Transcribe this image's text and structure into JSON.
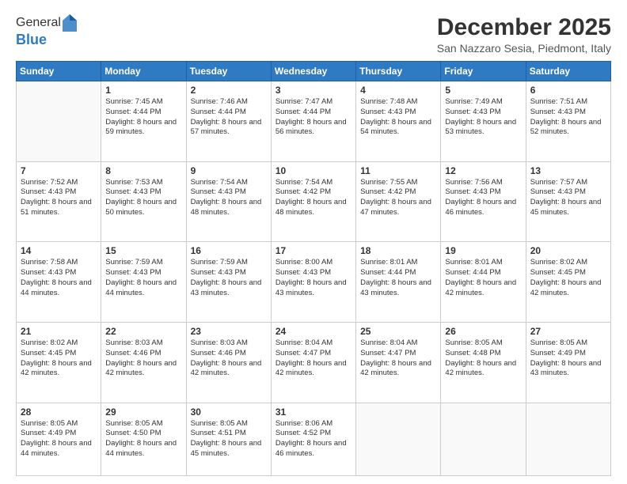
{
  "header": {
    "logo_general": "General",
    "logo_blue": "Blue",
    "month": "December 2025",
    "location": "San Nazzaro Sesia, Piedmont, Italy"
  },
  "days_of_week": [
    "Sunday",
    "Monday",
    "Tuesday",
    "Wednesday",
    "Thursday",
    "Friday",
    "Saturday"
  ],
  "weeks": [
    [
      {
        "day": "",
        "sunrise": "",
        "sunset": "",
        "daylight": ""
      },
      {
        "day": "1",
        "sunrise": "Sunrise: 7:45 AM",
        "sunset": "Sunset: 4:44 PM",
        "daylight": "Daylight: 8 hours and 59 minutes."
      },
      {
        "day": "2",
        "sunrise": "Sunrise: 7:46 AM",
        "sunset": "Sunset: 4:44 PM",
        "daylight": "Daylight: 8 hours and 57 minutes."
      },
      {
        "day": "3",
        "sunrise": "Sunrise: 7:47 AM",
        "sunset": "Sunset: 4:44 PM",
        "daylight": "Daylight: 8 hours and 56 minutes."
      },
      {
        "day": "4",
        "sunrise": "Sunrise: 7:48 AM",
        "sunset": "Sunset: 4:43 PM",
        "daylight": "Daylight: 8 hours and 54 minutes."
      },
      {
        "day": "5",
        "sunrise": "Sunrise: 7:49 AM",
        "sunset": "Sunset: 4:43 PM",
        "daylight": "Daylight: 8 hours and 53 minutes."
      },
      {
        "day": "6",
        "sunrise": "Sunrise: 7:51 AM",
        "sunset": "Sunset: 4:43 PM",
        "daylight": "Daylight: 8 hours and 52 minutes."
      }
    ],
    [
      {
        "day": "7",
        "sunrise": "Sunrise: 7:52 AM",
        "sunset": "Sunset: 4:43 PM",
        "daylight": "Daylight: 8 hours and 51 minutes."
      },
      {
        "day": "8",
        "sunrise": "Sunrise: 7:53 AM",
        "sunset": "Sunset: 4:43 PM",
        "daylight": "Daylight: 8 hours and 50 minutes."
      },
      {
        "day": "9",
        "sunrise": "Sunrise: 7:54 AM",
        "sunset": "Sunset: 4:43 PM",
        "daylight": "Daylight: 8 hours and 48 minutes."
      },
      {
        "day": "10",
        "sunrise": "Sunrise: 7:54 AM",
        "sunset": "Sunset: 4:42 PM",
        "daylight": "Daylight: 8 hours and 48 minutes."
      },
      {
        "day": "11",
        "sunrise": "Sunrise: 7:55 AM",
        "sunset": "Sunset: 4:42 PM",
        "daylight": "Daylight: 8 hours and 47 minutes."
      },
      {
        "day": "12",
        "sunrise": "Sunrise: 7:56 AM",
        "sunset": "Sunset: 4:43 PM",
        "daylight": "Daylight: 8 hours and 46 minutes."
      },
      {
        "day": "13",
        "sunrise": "Sunrise: 7:57 AM",
        "sunset": "Sunset: 4:43 PM",
        "daylight": "Daylight: 8 hours and 45 minutes."
      }
    ],
    [
      {
        "day": "14",
        "sunrise": "Sunrise: 7:58 AM",
        "sunset": "Sunset: 4:43 PM",
        "daylight": "Daylight: 8 hours and 44 minutes."
      },
      {
        "day": "15",
        "sunrise": "Sunrise: 7:59 AM",
        "sunset": "Sunset: 4:43 PM",
        "daylight": "Daylight: 8 hours and 44 minutes."
      },
      {
        "day": "16",
        "sunrise": "Sunrise: 7:59 AM",
        "sunset": "Sunset: 4:43 PM",
        "daylight": "Daylight: 8 hours and 43 minutes."
      },
      {
        "day": "17",
        "sunrise": "Sunrise: 8:00 AM",
        "sunset": "Sunset: 4:43 PM",
        "daylight": "Daylight: 8 hours and 43 minutes."
      },
      {
        "day": "18",
        "sunrise": "Sunrise: 8:01 AM",
        "sunset": "Sunset: 4:44 PM",
        "daylight": "Daylight: 8 hours and 43 minutes."
      },
      {
        "day": "19",
        "sunrise": "Sunrise: 8:01 AM",
        "sunset": "Sunset: 4:44 PM",
        "daylight": "Daylight: 8 hours and 42 minutes."
      },
      {
        "day": "20",
        "sunrise": "Sunrise: 8:02 AM",
        "sunset": "Sunset: 4:45 PM",
        "daylight": "Daylight: 8 hours and 42 minutes."
      }
    ],
    [
      {
        "day": "21",
        "sunrise": "Sunrise: 8:02 AM",
        "sunset": "Sunset: 4:45 PM",
        "daylight": "Daylight: 8 hours and 42 minutes."
      },
      {
        "day": "22",
        "sunrise": "Sunrise: 8:03 AM",
        "sunset": "Sunset: 4:46 PM",
        "daylight": "Daylight: 8 hours and 42 minutes."
      },
      {
        "day": "23",
        "sunrise": "Sunrise: 8:03 AM",
        "sunset": "Sunset: 4:46 PM",
        "daylight": "Daylight: 8 hours and 42 minutes."
      },
      {
        "day": "24",
        "sunrise": "Sunrise: 8:04 AM",
        "sunset": "Sunset: 4:47 PM",
        "daylight": "Daylight: 8 hours and 42 minutes."
      },
      {
        "day": "25",
        "sunrise": "Sunrise: 8:04 AM",
        "sunset": "Sunset: 4:47 PM",
        "daylight": "Daylight: 8 hours and 42 minutes."
      },
      {
        "day": "26",
        "sunrise": "Sunrise: 8:05 AM",
        "sunset": "Sunset: 4:48 PM",
        "daylight": "Daylight: 8 hours and 42 minutes."
      },
      {
        "day": "27",
        "sunrise": "Sunrise: 8:05 AM",
        "sunset": "Sunset: 4:49 PM",
        "daylight": "Daylight: 8 hours and 43 minutes."
      }
    ],
    [
      {
        "day": "28",
        "sunrise": "Sunrise: 8:05 AM",
        "sunset": "Sunset: 4:49 PM",
        "daylight": "Daylight: 8 hours and 44 minutes."
      },
      {
        "day": "29",
        "sunrise": "Sunrise: 8:05 AM",
        "sunset": "Sunset: 4:50 PM",
        "daylight": "Daylight: 8 hours and 44 minutes."
      },
      {
        "day": "30",
        "sunrise": "Sunrise: 8:05 AM",
        "sunset": "Sunset: 4:51 PM",
        "daylight": "Daylight: 8 hours and 45 minutes."
      },
      {
        "day": "31",
        "sunrise": "Sunrise: 8:06 AM",
        "sunset": "Sunset: 4:52 PM",
        "daylight": "Daylight: 8 hours and 46 minutes."
      },
      {
        "day": "",
        "sunrise": "",
        "sunset": "",
        "daylight": ""
      },
      {
        "day": "",
        "sunrise": "",
        "sunset": "",
        "daylight": ""
      },
      {
        "day": "",
        "sunrise": "",
        "sunset": "",
        "daylight": ""
      }
    ]
  ]
}
